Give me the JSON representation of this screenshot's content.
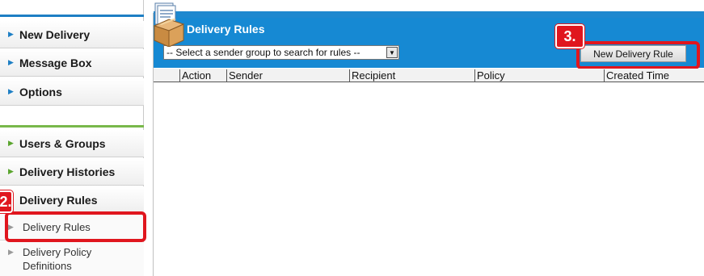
{
  "sidebar": {
    "top_items": [
      {
        "label": "New Delivery"
      },
      {
        "label": "Message Box"
      },
      {
        "label": "Options"
      }
    ],
    "admin_items": [
      {
        "label": "Users & Groups"
      },
      {
        "label": "Delivery Histories"
      },
      {
        "label": "Delivery Rules"
      }
    ],
    "sub_items": [
      {
        "label": "Delivery Rules"
      },
      {
        "label": "Delivery Policy Definitions"
      }
    ]
  },
  "main": {
    "title": "Delivery Rules",
    "sender_group_select": {
      "selected": "-- Select a sender group to search for rules --"
    },
    "new_rule_button": "New Delivery Rule",
    "table": {
      "columns": [
        "Action",
        "Sender",
        "Recipient",
        "Policy",
        "Created Time"
      ],
      "rows": []
    }
  },
  "callouts": {
    "step2": "2.",
    "step3": "3."
  },
  "colors": {
    "header_blue": "#1689d3",
    "callout_red": "#e0161e",
    "accent_green": "#78b84a"
  }
}
